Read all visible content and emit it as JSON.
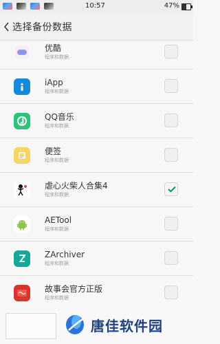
{
  "status_bar": {
    "time": "10:57",
    "battery_percent_label": "47%",
    "battery_fill_fraction": 0.47
  },
  "header": {
    "back_icon": "chevron-left-icon",
    "title": "选择备份数据"
  },
  "items": [
    {
      "name": "优酷",
      "subtitle": "程序和数据",
      "icon": "youku-icon",
      "checked": false,
      "icon_bg": "#f5f0f8"
    },
    {
      "name": "iApp",
      "subtitle": "程序和数据",
      "icon": "iapp-icon",
      "checked": false,
      "icon_bg": "#1689d8"
    },
    {
      "name": "QQ音乐",
      "subtitle": "程序和数据",
      "icon": "qq-music-icon",
      "checked": false,
      "icon_bg": "#2ec37b"
    },
    {
      "name": "便签",
      "subtitle": "程序和数据",
      "icon": "notes-icon",
      "checked": false,
      "icon_bg": "#f5d566"
    },
    {
      "name": "虐心火柴人合集4",
      "subtitle": "程序和数据",
      "icon": "stickman-icon",
      "checked": true,
      "icon_bg": "#ffffff"
    },
    {
      "name": "AETool",
      "subtitle": "程序和数据",
      "icon": "android-icon",
      "checked": false,
      "icon_bg": "#ffffff"
    },
    {
      "name": "ZArchiver",
      "subtitle": "程序和数据",
      "icon": "zarchiver-icon",
      "checked": false,
      "icon_bg": "#18a89a"
    },
    {
      "name": "故事会官方正版",
      "subtitle": "程序和数据",
      "icon": "story-icon",
      "checked": false,
      "icon_bg": "#d8342d"
    }
  ],
  "watermark": {
    "text": "唐佳软件园",
    "accent": "#21407f"
  },
  "colors": {
    "check_mark": "#138b63",
    "divider": "#e0e0e0",
    "text": "#333333",
    "subtext": "#a0a0a0"
  }
}
